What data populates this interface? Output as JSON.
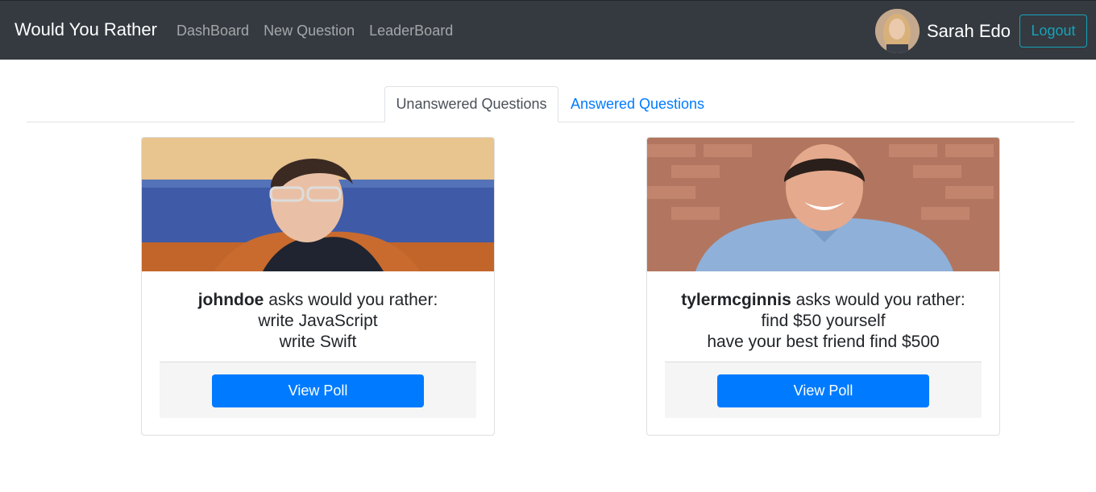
{
  "navbar": {
    "brand": "Would You Rather",
    "links": [
      "DashBoard",
      "New Question",
      "LeaderBoard"
    ],
    "user_name": "Sarah Edo",
    "logout_label": "Logout"
  },
  "tabs": [
    {
      "label": "Unanswered Questions",
      "active": true
    },
    {
      "label": "Answered Questions",
      "active": false
    }
  ],
  "questions": [
    {
      "author": "johndoe",
      "asks_text": " asks would you rather:",
      "option_one": "write JavaScript",
      "option_two": "write Swift",
      "button_label": "View Poll"
    },
    {
      "author": "tylermcginnis",
      "asks_text": " asks would you rather:",
      "option_one": "find $50 yourself",
      "option_two": "have your best friend find $500",
      "button_label": "View Poll"
    }
  ],
  "colors": {
    "navbar_bg": "#343a40",
    "primary": "#007bff",
    "logout_outline": "#17a2b8"
  }
}
